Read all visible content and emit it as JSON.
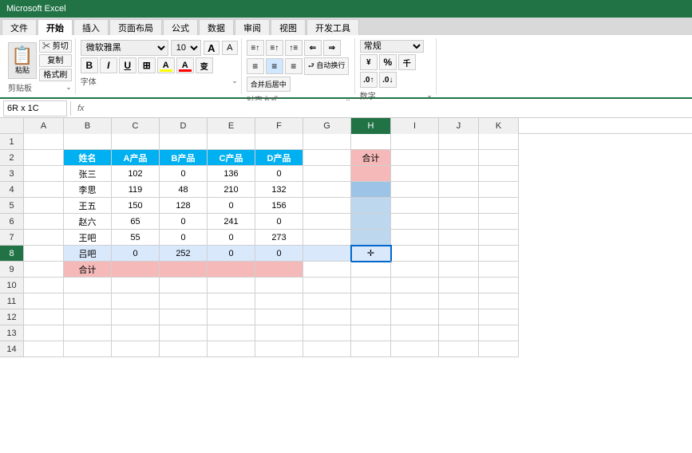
{
  "titleBar": {
    "title": "Microsoft Excel"
  },
  "ribbonTabs": [
    "文件",
    "开始",
    "插入",
    "页面布局",
    "公式",
    "数据",
    "审阅",
    "视图",
    "开发工具"
  ],
  "activeTab": "开始",
  "clipboard": {
    "paste": "粘贴",
    "cut": "✂ 剪切",
    "copy": "复制",
    "format": "格式刷",
    "label": "剪贴板"
  },
  "font": {
    "name": "微软雅黑",
    "size": "10",
    "bold": "B",
    "italic": "I",
    "underline": "U",
    "border": "⊞",
    "fill": "A",
    "color": "A",
    "label": "字体",
    "sizeUp": "A",
    "sizeDown": "A"
  },
  "alignment": {
    "label": "对齐方式",
    "autoWrap": "自动换行",
    "merge": "合并后居中"
  },
  "number": {
    "format": "常规",
    "label": "数字"
  },
  "formulaBar": {
    "nameBox": "6R x 1C",
    "fx": "fx",
    "formula": ""
  },
  "columns": [
    "A",
    "B",
    "C",
    "D",
    "E",
    "F",
    "G",
    "H",
    "I",
    "J",
    "K"
  ],
  "rows": [
    "1",
    "2",
    "3",
    "4",
    "5",
    "6",
    "7",
    "8",
    "9",
    "10",
    "11",
    "12",
    "13",
    "14"
  ],
  "tableData": {
    "headers": [
      "姓名",
      "A产品",
      "B产品",
      "C产品",
      "D产品",
      "合计"
    ],
    "rows": [
      {
        "name": "张三",
        "a": "102",
        "b": "0",
        "c": "136",
        "d": "0",
        "total": ""
      },
      {
        "name": "李思",
        "a": "119",
        "b": "48",
        "c": "210",
        "d": "132",
        "total": ""
      },
      {
        "name": "王五",
        "a": "150",
        "b": "128",
        "c": "0",
        "d": "156",
        "total": ""
      },
      {
        "name": "赵六",
        "a": "65",
        "b": "0",
        "c": "241",
        "d": "0",
        "total": ""
      },
      {
        "name": "王吧",
        "a": "55",
        "b": "0",
        "c": "0",
        "d": "273",
        "total": ""
      },
      {
        "name": "吕吧",
        "a": "0",
        "b": "252",
        "c": "0",
        "d": "0",
        "total": ""
      }
    ],
    "footer": "合计"
  },
  "selectedRange": "6R x 1C"
}
